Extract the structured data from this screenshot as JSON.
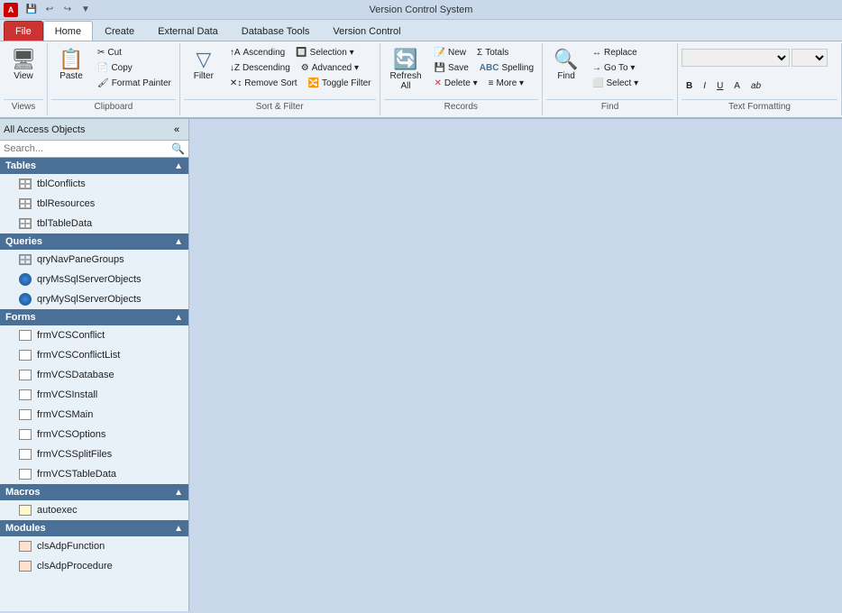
{
  "window": {
    "title": "Version Control System"
  },
  "titlebar": {
    "app_icon": "A",
    "quick_access": [
      "save",
      "undo",
      "redo",
      "customize"
    ]
  },
  "tabs": [
    {
      "id": "file",
      "label": "File",
      "active": false,
      "type": "file"
    },
    {
      "id": "home",
      "label": "Home",
      "active": true
    },
    {
      "id": "create",
      "label": "Create",
      "active": false
    },
    {
      "id": "external_data",
      "label": "External Data",
      "active": false
    },
    {
      "id": "database_tools",
      "label": "Database Tools",
      "active": false
    },
    {
      "id": "version_control",
      "label": "Version Control",
      "active": false
    }
  ],
  "ribbon": {
    "groups": [
      {
        "id": "views",
        "label": "Views",
        "buttons_large": [
          {
            "id": "view",
            "label": "View",
            "icon": "🖥"
          }
        ]
      },
      {
        "id": "clipboard",
        "label": "Clipboard",
        "buttons_large": [
          {
            "id": "paste",
            "label": "Paste",
            "icon": "📋"
          }
        ],
        "buttons_small": [
          {
            "id": "cut",
            "label": "Cut",
            "icon": "✂"
          },
          {
            "id": "copy",
            "label": "Copy",
            "icon": "📄"
          },
          {
            "id": "format_painter",
            "label": "Format Painter",
            "icon": "🖌"
          }
        ]
      },
      {
        "id": "sort_filter",
        "label": "Sort & Filter",
        "buttons_large": [
          {
            "id": "filter",
            "label": "Filter",
            "icon": "🔽"
          }
        ],
        "buttons_small": [
          {
            "id": "ascending",
            "label": "Ascending",
            "icon": "↑"
          },
          {
            "id": "selection",
            "label": "Selection ▾",
            "icon": ""
          },
          {
            "id": "descending",
            "label": "Descending",
            "icon": "↓"
          },
          {
            "id": "advanced",
            "label": "Advanced ▾",
            "icon": ""
          },
          {
            "id": "remove_sort",
            "label": "Remove Sort",
            "icon": ""
          },
          {
            "id": "toggle_filter",
            "label": "Toggle Filter",
            "icon": ""
          }
        ]
      },
      {
        "id": "records",
        "label": "Records",
        "buttons_large": [
          {
            "id": "refresh_all",
            "label": "Refresh All",
            "icon": "🔄"
          }
        ],
        "buttons_small": [
          {
            "id": "new",
            "label": "New",
            "icon": "+"
          },
          {
            "id": "totals",
            "label": "Totals",
            "icon": "Σ"
          },
          {
            "id": "save",
            "label": "Save",
            "icon": "💾"
          },
          {
            "id": "spelling",
            "label": "Spelling",
            "icon": "ABC"
          },
          {
            "id": "delete",
            "label": "Delete ▾",
            "icon": "✕"
          },
          {
            "id": "more",
            "label": "More ▾",
            "icon": ""
          }
        ]
      },
      {
        "id": "find",
        "label": "Find",
        "buttons_large": [
          {
            "id": "find_btn",
            "label": "Find",
            "icon": "🔍"
          }
        ],
        "buttons_small": [
          {
            "id": "replace",
            "label": "Replace",
            "icon": ""
          },
          {
            "id": "go_to",
            "label": "Go To ▾",
            "icon": ""
          },
          {
            "id": "select",
            "label": "Select ▾",
            "icon": ""
          }
        ]
      },
      {
        "id": "text_formatting",
        "label": "Text Formatting",
        "buttons_small": [
          {
            "id": "bold",
            "label": "B",
            "icon": ""
          },
          {
            "id": "italic",
            "label": "I",
            "icon": ""
          },
          {
            "id": "underline",
            "label": "U",
            "icon": ""
          },
          {
            "id": "font_color",
            "label": "A",
            "icon": ""
          },
          {
            "id": "highlight",
            "label": "ab",
            "icon": ""
          }
        ]
      }
    ]
  },
  "nav_pane": {
    "title": "All Access Objects",
    "search_placeholder": "Search...",
    "sections": [
      {
        "id": "tables",
        "label": "Tables",
        "type": "table",
        "items": [
          {
            "id": "tblConflicts",
            "label": "tblConflicts",
            "type": "table"
          },
          {
            "id": "tblResources",
            "label": "tblResources",
            "type": "table"
          },
          {
            "id": "tblTableData",
            "label": "tblTableData",
            "type": "table"
          }
        ]
      },
      {
        "id": "queries",
        "label": "Queries",
        "type": "query",
        "items": [
          {
            "id": "qryNavPaneGroups",
            "label": "qryNavPaneGroups",
            "type": "query"
          },
          {
            "id": "qryMsSqlServerObjects",
            "label": "qryMsSqlServerObjects",
            "type": "query_globe"
          },
          {
            "id": "qryMySqlServerObjects",
            "label": "qryMySqlServerObjects",
            "type": "query_globe"
          }
        ]
      },
      {
        "id": "forms",
        "label": "Forms",
        "type": "form",
        "items": [
          {
            "id": "frmVCSConflict",
            "label": "frmVCSConflict",
            "type": "form"
          },
          {
            "id": "frmVCSConflictList",
            "label": "frmVCSConflictList",
            "type": "form"
          },
          {
            "id": "frmVCSDatabase",
            "label": "frmVCSDatabase",
            "type": "form"
          },
          {
            "id": "frmVCSInstall",
            "label": "frmVCSInstall",
            "type": "form"
          },
          {
            "id": "frmVCSMain",
            "label": "frmVCSMain",
            "type": "form"
          },
          {
            "id": "frmVCSOptions",
            "label": "frmVCSOptions",
            "type": "form"
          },
          {
            "id": "frmVCSSplitFiles",
            "label": "frmVCSSplitFiles",
            "type": "form"
          },
          {
            "id": "frmVCSTableData",
            "label": "frmVCSTableData",
            "type": "form"
          }
        ]
      },
      {
        "id": "macros",
        "label": "Macros",
        "type": "macro",
        "items": [
          {
            "id": "autoexec",
            "label": "autoexec",
            "type": "macro"
          }
        ]
      },
      {
        "id": "modules",
        "label": "Modules",
        "type": "module",
        "items": [
          {
            "id": "clsAdpFunction",
            "label": "clsAdpFunction",
            "type": "module"
          },
          {
            "id": "clsAdpProcedure",
            "label": "clsAdpProcedure",
            "type": "module"
          }
        ]
      }
    ]
  }
}
